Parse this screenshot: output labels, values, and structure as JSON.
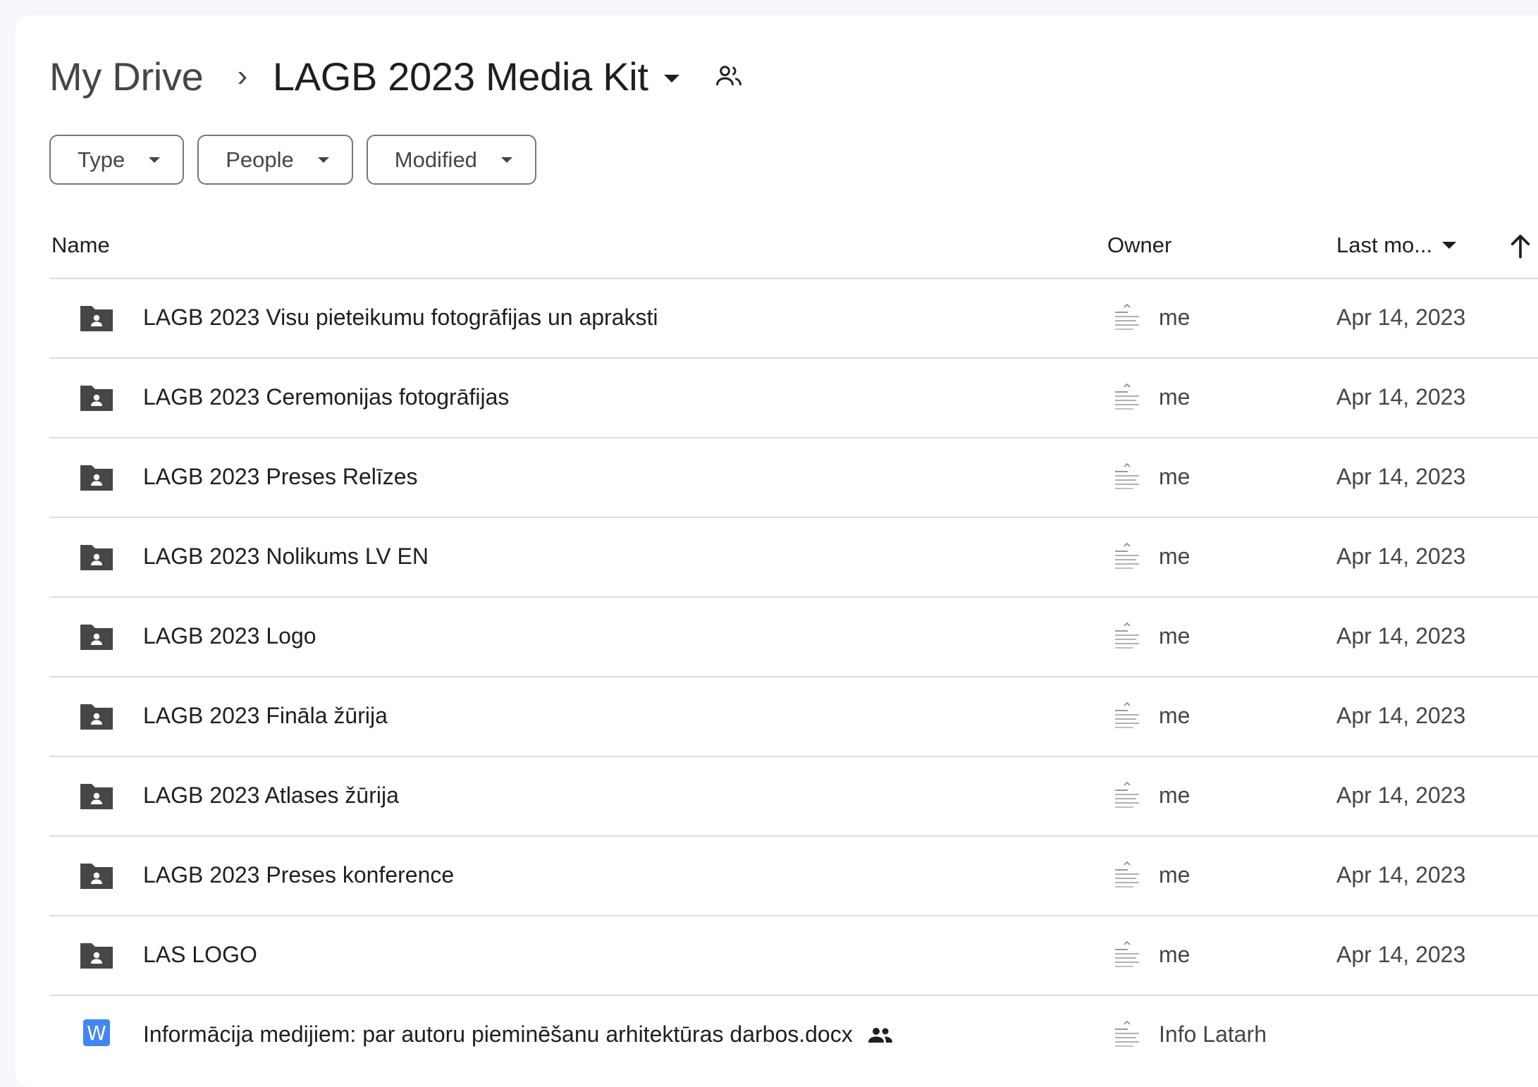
{
  "breadcrumb": {
    "root": "My Drive",
    "separator": "›",
    "current": "LAGB 2023 Media Kit"
  },
  "filters": [
    {
      "label": "Type"
    },
    {
      "label": "People"
    },
    {
      "label": "Modified"
    }
  ],
  "columns": {
    "name": "Name",
    "owner": "Owner",
    "last_modified": "Last mo..."
  },
  "rows": [
    {
      "name": "LAGB 2023 Visu pieteikumu fotogrāfijas un apraksti",
      "owner": "me",
      "date": "Apr 14, 2023",
      "type": "shared-folder"
    },
    {
      "name": "LAGB 2023 Ceremonijas fotogrāfijas",
      "owner": "me",
      "date": "Apr 14, 2023",
      "type": "shared-folder"
    },
    {
      "name": "LAGB 2023 Preses Relīzes",
      "owner": "me",
      "date": "Apr 14, 2023",
      "type": "shared-folder"
    },
    {
      "name": "LAGB 2023 Nolikums LV EN",
      "owner": "me",
      "date": "Apr 14, 2023",
      "type": "shared-folder"
    },
    {
      "name": "LAGB 2023 Logo",
      "owner": "me",
      "date": "Apr 14, 2023",
      "type": "shared-folder"
    },
    {
      "name": "LAGB 2023 Fināla žūrija",
      "owner": "me",
      "date": "Apr 14, 2023",
      "type": "shared-folder"
    },
    {
      "name": "LAGB 2023 Atlases žūrija",
      "owner": "me",
      "date": "Apr 14, 2023",
      "type": "shared-folder"
    },
    {
      "name": "LAGB 2023 Preses konference",
      "owner": "me",
      "date": "Apr 14, 2023",
      "type": "shared-folder"
    },
    {
      "name": "LAS LOGO",
      "owner": "me",
      "date": "Apr 14, 2023",
      "type": "shared-folder"
    },
    {
      "name": "Informācija medijiem: par autoru pieminēšanu arhitektūras darbos.docx",
      "owner": "Info Latarh",
      "date": "",
      "type": "word-doc",
      "icon_letter": "W"
    }
  ],
  "colors": {
    "background": "#f6f8fc",
    "panel": "#ffffff",
    "text_primary": "#1f1f1f",
    "text_secondary": "#444746",
    "divider": "#dadce0",
    "word_blue": "#4285f4",
    "folder_icon": "#444746"
  },
  "icons": {
    "header_shared": "people-outline-icon",
    "sort": "arrow-up-icon",
    "folder": "shared-folder-icon",
    "doc": "word-doc-icon",
    "row_shared": "people-icon",
    "owner": "owner-avatar-icon"
  }
}
